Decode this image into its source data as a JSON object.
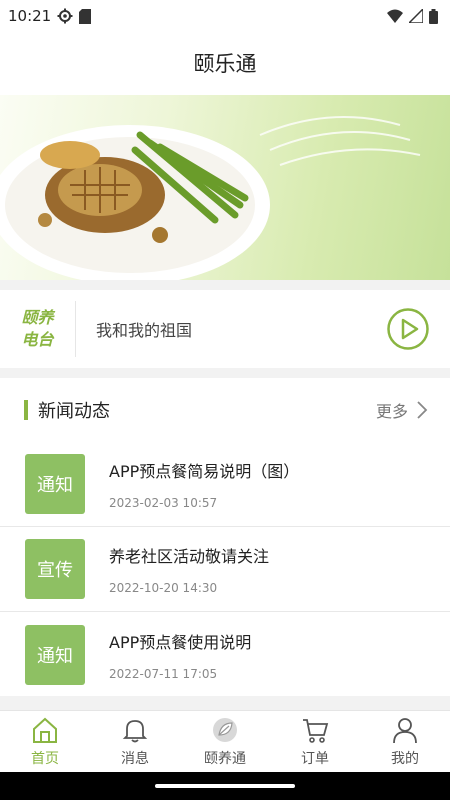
{
  "status_bar": {
    "time": "10:21"
  },
  "header": {
    "title": "颐乐通"
  },
  "radio": {
    "tag_line1": "颐养",
    "tag_line2": "电台",
    "title": "我和我的祖国"
  },
  "news": {
    "title": "新闻动态",
    "more_label": "更多",
    "items": [
      {
        "badge": "通知",
        "title": "APP预点餐简易说明（图）",
        "date": "2023-02-03 10:57"
      },
      {
        "badge": "宣传",
        "title": "养老社区活动敬请关注",
        "date": "2022-10-20 14:30"
      },
      {
        "badge": "通知",
        "title": "APP预点餐使用说明",
        "date": "2022-07-11 17:05"
      }
    ]
  },
  "tabs": [
    {
      "label": "首页",
      "icon": "home-icon",
      "active": true
    },
    {
      "label": "消息",
      "icon": "bell-icon",
      "active": false
    },
    {
      "label": "颐养通",
      "icon": "leaf-icon",
      "active": false
    },
    {
      "label": "订单",
      "icon": "cart-icon",
      "active": false
    },
    {
      "label": "我的",
      "icon": "user-icon",
      "active": false
    }
  ],
  "colors": {
    "accent": "#8ab542",
    "badge": "#8ec063"
  }
}
